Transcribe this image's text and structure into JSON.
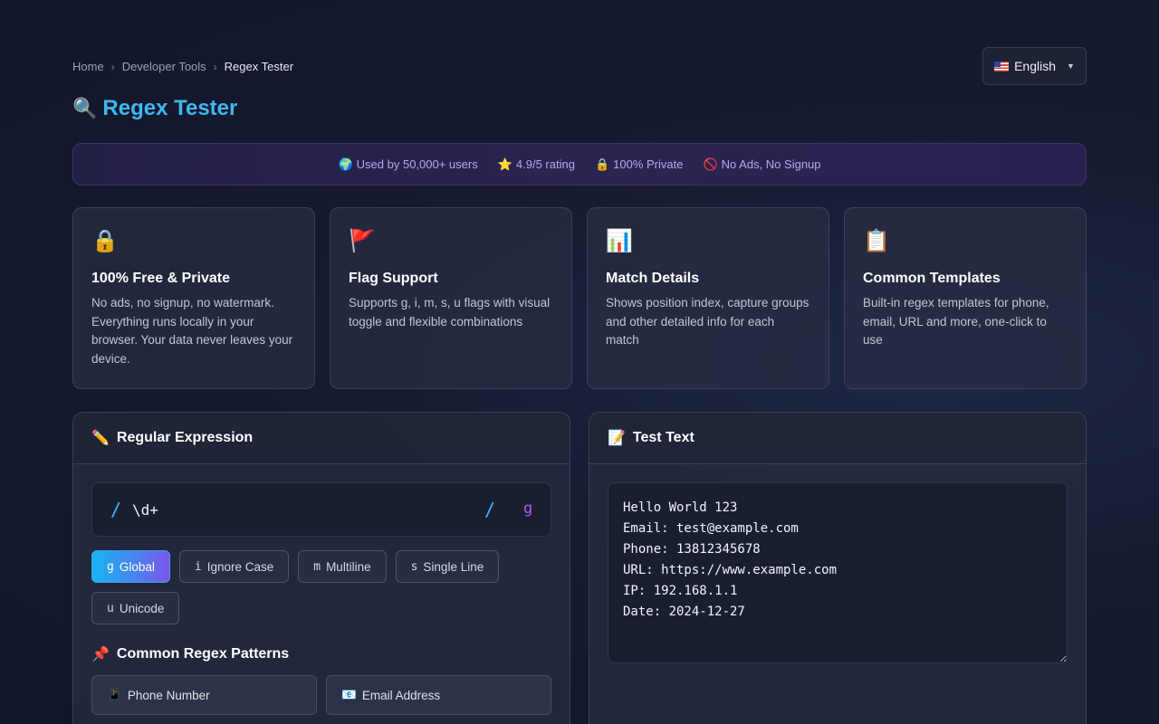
{
  "breadcrumb": {
    "home": "Home",
    "section": "Developer Tools",
    "current": "Regex Tester",
    "separator": "›"
  },
  "language": {
    "label": "English",
    "caret": "▼"
  },
  "title": {
    "icon": "🔍",
    "text": "Regex Tester"
  },
  "stats": [
    {
      "icon": "🌍",
      "text": "Used by 50,000+ users"
    },
    {
      "icon": "⭐",
      "text": "4.9/5 rating"
    },
    {
      "icon": "🔒",
      "text": "100% Private"
    },
    {
      "icon": "🚫",
      "text": "No Ads, No Signup"
    }
  ],
  "features": [
    {
      "icon": "🔒",
      "title": "100% Free & Private",
      "desc": "No ads, no signup, no watermark. Everything runs locally in your browser. Your data never leaves your device."
    },
    {
      "icon": "🚩",
      "title": "Flag Support",
      "desc": "Supports g, i, m, s, u flags with visual toggle and flexible combinations"
    },
    {
      "icon": "📊",
      "title": "Match Details",
      "desc": "Shows position index, capture groups and other detailed info for each match"
    },
    {
      "icon": "📋",
      "title": "Common Templates",
      "desc": "Built-in regex templates for phone, email, URL and more, one-click to use"
    }
  ],
  "regex_panel": {
    "icon": "✏️",
    "title": "Regular Expression",
    "slash": "/",
    "pattern": "\\d+",
    "active_flags": "g",
    "flags": [
      {
        "key": "g",
        "label": "Global",
        "active": true
      },
      {
        "key": "i",
        "label": "Ignore Case",
        "active": false
      },
      {
        "key": "m",
        "label": "Multiline",
        "active": false
      },
      {
        "key": "s",
        "label": "Single Line",
        "active": false
      },
      {
        "key": "u",
        "label": "Unicode",
        "active": false
      }
    ],
    "patterns_icon": "📌",
    "patterns_title": "Common Regex Patterns",
    "patterns": [
      {
        "icon": "📱",
        "label": "Phone Number"
      },
      {
        "icon": "📧",
        "label": "Email Address"
      }
    ]
  },
  "test_panel": {
    "icon": "📝",
    "title": "Test Text",
    "text": "Hello World 123\nEmail: test@example.com\nPhone: 13812345678\nURL: https://www.example.com\nIP: 192.168.1.1\nDate: 2024-12-27"
  }
}
